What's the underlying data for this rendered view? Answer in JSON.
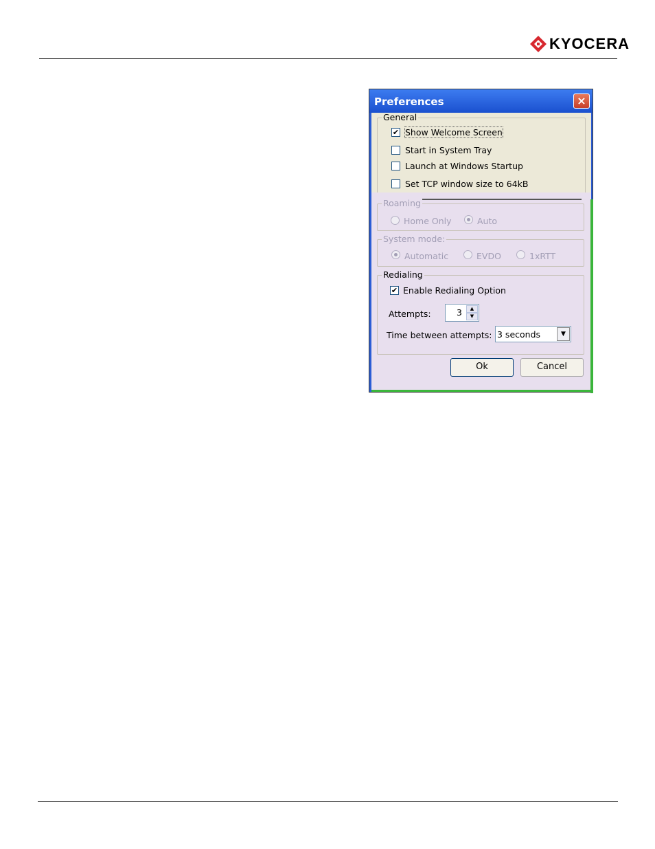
{
  "header": {
    "brand": "KYOCERA"
  },
  "dialog": {
    "title": "Preferences",
    "close_glyph": "×",
    "general": {
      "label": "General",
      "items": [
        {
          "label": "Show Welcome Screen",
          "checked": true
        },
        {
          "label": "Start in System Tray",
          "checked": false
        },
        {
          "label": "Launch at Windows Startup",
          "checked": false
        },
        {
          "label": "Set TCP window size to 64kB",
          "checked": false
        }
      ]
    },
    "roaming": {
      "label": "Roaming",
      "options": [
        {
          "label": "Home Only",
          "selected": false
        },
        {
          "label": "Auto",
          "selected": true
        }
      ]
    },
    "system_mode": {
      "label": "System mode:",
      "options": [
        {
          "label": "Automatic",
          "selected": true
        },
        {
          "label": "EVDO",
          "selected": false
        },
        {
          "label": "1xRTT",
          "selected": false
        }
      ]
    },
    "redialing": {
      "label": "Redialing",
      "enable_label": "Enable Redialing Option",
      "enable_checked": true,
      "attempts_label": "Attempts:",
      "attempts_value": "3",
      "time_label": "Time between attempts:",
      "time_value": "3 seconds"
    },
    "ok_label": "Ok",
    "cancel_label": "Cancel"
  }
}
